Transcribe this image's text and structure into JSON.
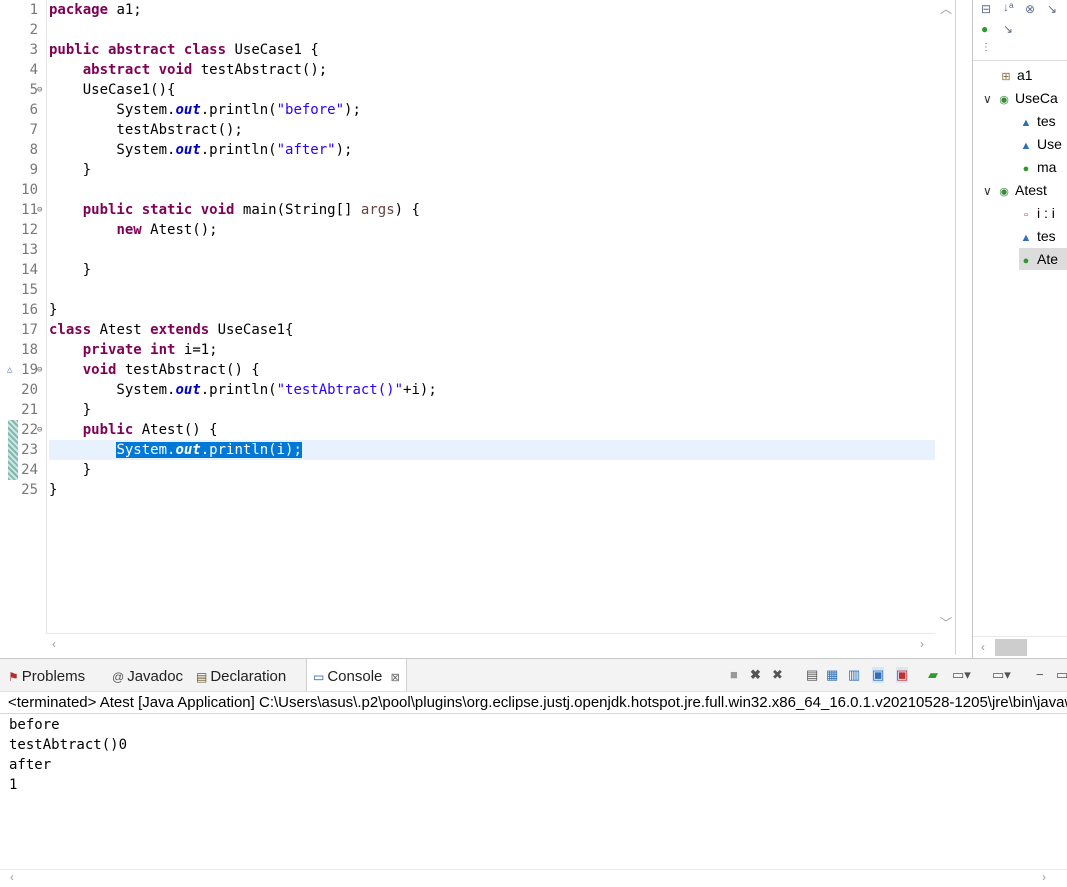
{
  "editor": {
    "lines": [
      {
        "n": "1",
        "fold": "",
        "ovr": "",
        "tokens": [
          {
            "t": "package",
            "c": "kw"
          },
          {
            "t": " a1;",
            "c": ""
          }
        ]
      },
      {
        "n": "2",
        "fold": "",
        "ovr": "",
        "tokens": []
      },
      {
        "n": "3",
        "fold": "",
        "ovr": "",
        "tokens": [
          {
            "t": "public",
            "c": "kw"
          },
          {
            "t": " ",
            "c": ""
          },
          {
            "t": "abstract",
            "c": "kw"
          },
          {
            "t": " ",
            "c": ""
          },
          {
            "t": "class",
            "c": "kw"
          },
          {
            "t": " UseCase1 {",
            "c": ""
          }
        ]
      },
      {
        "n": "4",
        "fold": "",
        "ovr": "",
        "tokens": [
          {
            "t": "    ",
            "c": ""
          },
          {
            "t": "abstract",
            "c": "kw"
          },
          {
            "t": " ",
            "c": ""
          },
          {
            "t": "void",
            "c": "kw"
          },
          {
            "t": " testAbstract();",
            "c": ""
          }
        ]
      },
      {
        "n": "5",
        "fold": "⊖",
        "ovr": "",
        "tokens": [
          {
            "t": "    UseCase1(){",
            "c": ""
          }
        ]
      },
      {
        "n": "6",
        "fold": "",
        "ovr": "",
        "tokens": [
          {
            "t": "        System.",
            "c": ""
          },
          {
            "t": "out",
            "c": "fld"
          },
          {
            "t": ".println(",
            "c": ""
          },
          {
            "t": "\"before\"",
            "c": "str"
          },
          {
            "t": ");",
            "c": ""
          }
        ]
      },
      {
        "n": "7",
        "fold": "",
        "ovr": "",
        "tokens": [
          {
            "t": "        testAbstract();",
            "c": ""
          }
        ]
      },
      {
        "n": "8",
        "fold": "",
        "ovr": "",
        "tokens": [
          {
            "t": "        System.",
            "c": ""
          },
          {
            "t": "out",
            "c": "fld"
          },
          {
            "t": ".println(",
            "c": ""
          },
          {
            "t": "\"after\"",
            "c": "str"
          },
          {
            "t": ");",
            "c": ""
          }
        ]
      },
      {
        "n": "9",
        "fold": "",
        "ovr": "",
        "tokens": [
          {
            "t": "    }",
            "c": ""
          }
        ]
      },
      {
        "n": "10",
        "fold": "",
        "ovr": "",
        "tokens": []
      },
      {
        "n": "11",
        "fold": "⊖",
        "ovr": "",
        "tokens": [
          {
            "t": "    ",
            "c": ""
          },
          {
            "t": "public",
            "c": "kw"
          },
          {
            "t": " ",
            "c": ""
          },
          {
            "t": "static",
            "c": "kw"
          },
          {
            "t": " ",
            "c": ""
          },
          {
            "t": "void",
            "c": "kw"
          },
          {
            "t": " main(String[] ",
            "c": ""
          },
          {
            "t": "args",
            "c": "par"
          },
          {
            "t": ") {",
            "c": ""
          }
        ]
      },
      {
        "n": "12",
        "fold": "",
        "ovr": "",
        "tokens": [
          {
            "t": "        ",
            "c": ""
          },
          {
            "t": "new",
            "c": "kw"
          },
          {
            "t": " Atest();",
            "c": ""
          }
        ]
      },
      {
        "n": "13",
        "fold": "",
        "ovr": "",
        "tokens": []
      },
      {
        "n": "14",
        "fold": "",
        "ovr": "",
        "tokens": [
          {
            "t": "    }",
            "c": ""
          }
        ]
      },
      {
        "n": "15",
        "fold": "",
        "ovr": "",
        "tokens": []
      },
      {
        "n": "16",
        "fold": "",
        "ovr": "",
        "tokens": [
          {
            "t": "}",
            "c": ""
          }
        ]
      },
      {
        "n": "17",
        "fold": "",
        "ovr": "",
        "tokens": [
          {
            "t": "class",
            "c": "kw"
          },
          {
            "t": " Atest ",
            "c": ""
          },
          {
            "t": "extends",
            "c": "kw"
          },
          {
            "t": " UseCase1{",
            "c": ""
          }
        ]
      },
      {
        "n": "18",
        "fold": "",
        "ovr": "",
        "tokens": [
          {
            "t": "    ",
            "c": ""
          },
          {
            "t": "private",
            "c": "kw"
          },
          {
            "t": " ",
            "c": ""
          },
          {
            "t": "int",
            "c": "kw"
          },
          {
            "t": " i=1;",
            "c": ""
          }
        ]
      },
      {
        "n": "19",
        "fold": "⊖",
        "ovr": "△",
        "tokens": [
          {
            "t": "    ",
            "c": ""
          },
          {
            "t": "void",
            "c": "kw"
          },
          {
            "t": " testAbstract() {",
            "c": ""
          }
        ]
      },
      {
        "n": "20",
        "fold": "",
        "ovr": "",
        "tokens": [
          {
            "t": "        System.",
            "c": ""
          },
          {
            "t": "out",
            "c": "fld"
          },
          {
            "t": ".println(",
            "c": ""
          },
          {
            "t": "\"testAbtract()\"",
            "c": "str"
          },
          {
            "t": "+i);",
            "c": ""
          }
        ]
      },
      {
        "n": "21",
        "fold": "",
        "ovr": "",
        "tokens": [
          {
            "t": "    }",
            "c": ""
          }
        ]
      },
      {
        "n": "22",
        "fold": "⊖",
        "ovr": "",
        "tokens": [
          {
            "t": "    ",
            "c": ""
          },
          {
            "t": "public",
            "c": "kw"
          },
          {
            "t": " Atest() {",
            "c": ""
          }
        ]
      },
      {
        "n": "23",
        "fold": "",
        "ovr": "",
        "sel": true,
        "lead": "        ",
        "tokens": [
          {
            "t": "System.",
            "c": ""
          },
          {
            "t": "out",
            "c": "fld"
          },
          {
            "t": ".println(i);",
            "c": ""
          }
        ]
      },
      {
        "n": "24",
        "fold": "",
        "ovr": "",
        "tokens": [
          {
            "t": "    }",
            "c": ""
          }
        ]
      },
      {
        "n": "25",
        "fold": "",
        "ovr": "",
        "tokens": [
          {
            "t": "}",
            "c": ""
          }
        ]
      }
    ]
  },
  "outline": {
    "items": [
      {
        "indent": 1,
        "twist": "",
        "icon": "⊞",
        "icon_color": "#8a6d3b",
        "label": "a1"
      },
      {
        "indent": 0,
        "twist": "∨",
        "icon": "◉",
        "icon_color": "#3a8a3a",
        "label": "UseCa"
      },
      {
        "indent": 2,
        "twist": "",
        "icon": "▲",
        "icon_color": "#2d6fb8",
        "label": "tes"
      },
      {
        "indent": 2,
        "twist": "",
        "icon": "▲",
        "icon_color": "#2d6fb8",
        "label": "Use"
      },
      {
        "indent": 2,
        "twist": "",
        "icon": "●",
        "icon_color": "#2e9a2e",
        "label": "ma"
      },
      {
        "indent": 0,
        "twist": "∨",
        "icon": "◉",
        "icon_color": "#3a8a3a",
        "label": "Atest"
      },
      {
        "indent": 2,
        "twist": "",
        "icon": "▫",
        "icon_color": "#c0304a",
        "label": "i : i"
      },
      {
        "indent": 2,
        "twist": "",
        "icon": "▲",
        "icon_color": "#2d6fb8",
        "label": "tes"
      },
      {
        "indent": 2,
        "twist": "",
        "icon": "●",
        "icon_color": "#2e9a2e",
        "label": "Ate",
        "selected": true
      }
    ]
  },
  "panel": {
    "tabs": [
      {
        "icon": "⚑",
        "label": "Problems"
      },
      {
        "icon": "@",
        "label": "Javadoc"
      },
      {
        "icon": "▤",
        "label": "Declaration"
      },
      {
        "icon": "▭",
        "label": "Console",
        "close": "⊠"
      }
    ],
    "status": "<terminated> Atest [Java Application] C:\\Users\\asus\\.p2\\pool\\plugins\\org.eclipse.justj.openjdk.hotspot.jre.full.win32.x86_64_16.0.1.v20210528-1205\\jre\\bin\\javaw.exe",
    "output": [
      "before",
      "testAbtract()0",
      "after",
      "1"
    ]
  }
}
